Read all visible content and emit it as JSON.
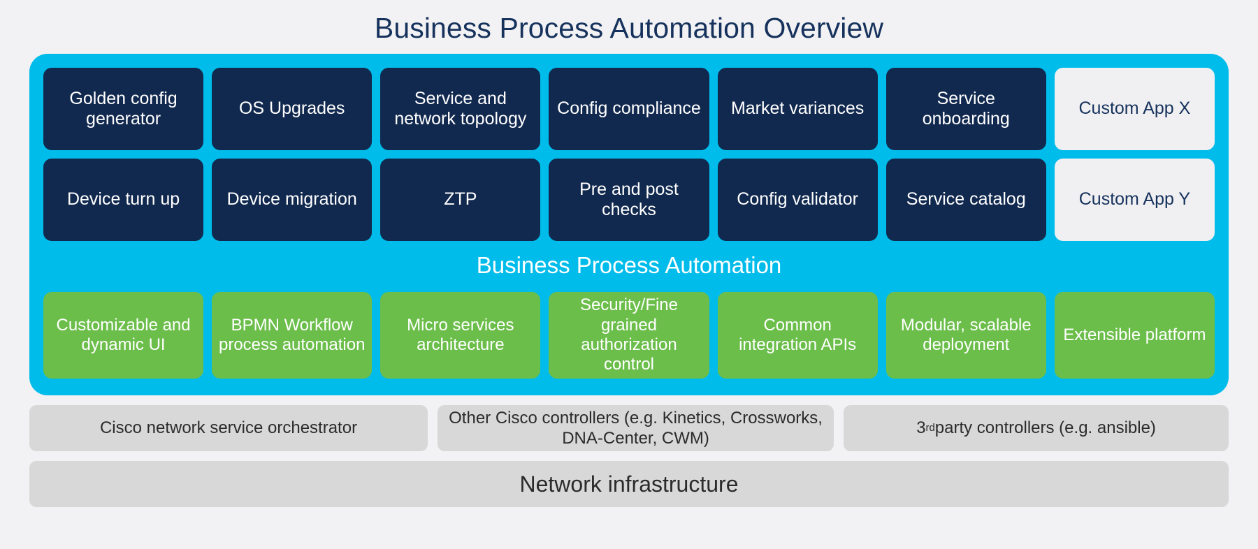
{
  "title": "Business Process Automation Overview",
  "colors": {
    "page_background": "#f2f2f4",
    "platform_cyan": "#00bceb",
    "app_dark_navy": "#12294f",
    "custom_app_light": "#f0f0f2",
    "feature_green": "#6cbe4b",
    "controller_gray": "#d8d8d8",
    "title_navy": "#16325c"
  },
  "platform": {
    "banner_label": "Business Process Automation",
    "apps_row_1": [
      {
        "label": "Golden config generator",
        "style": "dark"
      },
      {
        "label": "OS Upgrades",
        "style": "dark"
      },
      {
        "label": "Service and network topology",
        "style": "dark"
      },
      {
        "label": "Config compliance",
        "style": "dark"
      },
      {
        "label": "Market variances",
        "style": "dark"
      },
      {
        "label": "Service onboarding",
        "style": "dark"
      },
      {
        "label": "Custom App X",
        "style": "light"
      }
    ],
    "apps_row_2": [
      {
        "label": "Device turn up",
        "style": "dark"
      },
      {
        "label": "Device migration",
        "style": "dark"
      },
      {
        "label": "ZTP",
        "style": "dark"
      },
      {
        "label": "Pre and post checks",
        "style": "dark"
      },
      {
        "label": "Config validator",
        "style": "dark"
      },
      {
        "label": "Service catalog",
        "style": "dark"
      },
      {
        "label": "Custom App Y",
        "style": "light"
      }
    ],
    "features": [
      {
        "label": "Customizable and dynamic UI"
      },
      {
        "label": "BPMN Workflow process automation"
      },
      {
        "label": "Micro services architecture"
      },
      {
        "label": "Security/Fine grained authorization control"
      },
      {
        "label": "Common integration APIs"
      },
      {
        "label": "Modular, scalable deployment"
      },
      {
        "label": "Extensible platform"
      }
    ]
  },
  "controllers": [
    {
      "label": "Cisco network service orchestrator"
    },
    {
      "label": "Other Cisco controllers (e.g. Kinetics, Crossworks, DNA-Center, CWM)"
    },
    {
      "label_prefix": "3",
      "label_sup": "rd",
      "label_suffix": " party controllers (e.g. ansible)"
    }
  ],
  "infrastructure": {
    "label": "Network infrastructure"
  }
}
